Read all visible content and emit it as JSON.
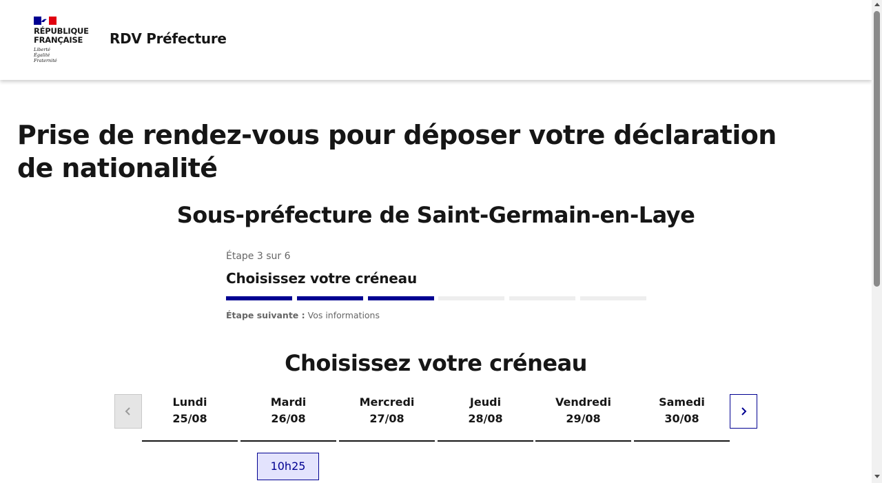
{
  "header": {
    "brand_title": "RÉPUBLIQUE\nFRANÇAISE",
    "brand_motto": "Liberté\nÉgalité\nFraternité",
    "service_name": "RDV Préfecture"
  },
  "main": {
    "page_title": "Prise de rendez-vous pour déposer votre déclaration de nationalité",
    "office_title": "Sous-préfecture de Saint-Germain-en-Laye"
  },
  "stepper": {
    "state": "Étape 3 sur 6",
    "title": "Choisissez votre créneau",
    "current_step": 3,
    "total_steps": 6,
    "next_label": "Étape suivante :",
    "next_value": "Vos informations"
  },
  "calendar": {
    "title": "Choisissez votre créneau",
    "prev_icon": "chevron-left-icon",
    "next_icon": "chevron-right-icon",
    "days": [
      {
        "name": "Lundi",
        "date": "25/08"
      },
      {
        "name": "Mardi",
        "date": "26/08"
      },
      {
        "name": "Mercredi",
        "date": "27/08"
      },
      {
        "name": "Jeudi",
        "date": "28/08"
      },
      {
        "name": "Vendredi",
        "date": "29/08"
      },
      {
        "name": "Samedi",
        "date": "30/08"
      }
    ],
    "slots": [
      {
        "day": "Mardi",
        "time": "10h25"
      }
    ]
  },
  "colors": {
    "accent": "#000091",
    "flag_red": "#e1000f",
    "slot_bg": "#e3e3fd",
    "inactive_bar": "#eeeeee"
  }
}
